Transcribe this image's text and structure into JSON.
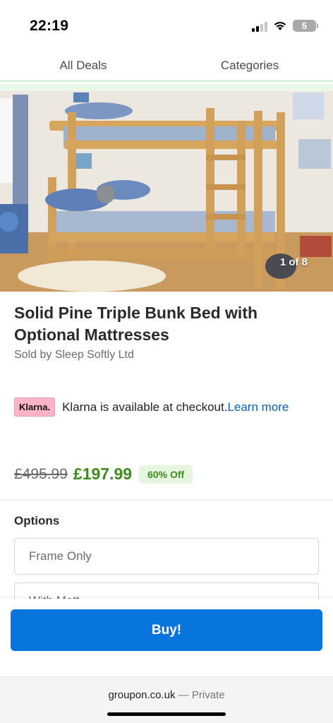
{
  "status_bar": {
    "time": "22:19",
    "battery_level": "5",
    "icons": [
      "signal-icon",
      "wifi-icon",
      "battery-icon"
    ]
  },
  "nav": {
    "tabs": [
      {
        "label": "All Deals"
      },
      {
        "label": "Categories"
      }
    ]
  },
  "gallery": {
    "counter": "1 of 8",
    "current_index": 1,
    "total": 8
  },
  "product": {
    "title": "Solid Pine Triple Bunk Bed with Optional Mattresses",
    "seller": "Sold by Sleep Softly Ltd"
  },
  "klarna": {
    "badge": "Klarna.",
    "text": "Klarna is available at checkout.",
    "link": "Learn more"
  },
  "pricing": {
    "original_price": "£495.99",
    "sale_price": "£197.99",
    "discount": "60% Off"
  },
  "options": {
    "label": "Options",
    "items": [
      {
        "label": "Frame Only"
      },
      {
        "label": "With Matt"
      }
    ]
  },
  "cta": {
    "buy_label": "Buy!"
  },
  "browser": {
    "domain": "groupon.co.uk",
    "separator": "—",
    "mode": "Private"
  },
  "colors": {
    "accent_blue": "#0874de",
    "price_green": "#3d8c1c",
    "klarna_pink": "#ffb3c7",
    "link_blue": "#0b5fae"
  }
}
